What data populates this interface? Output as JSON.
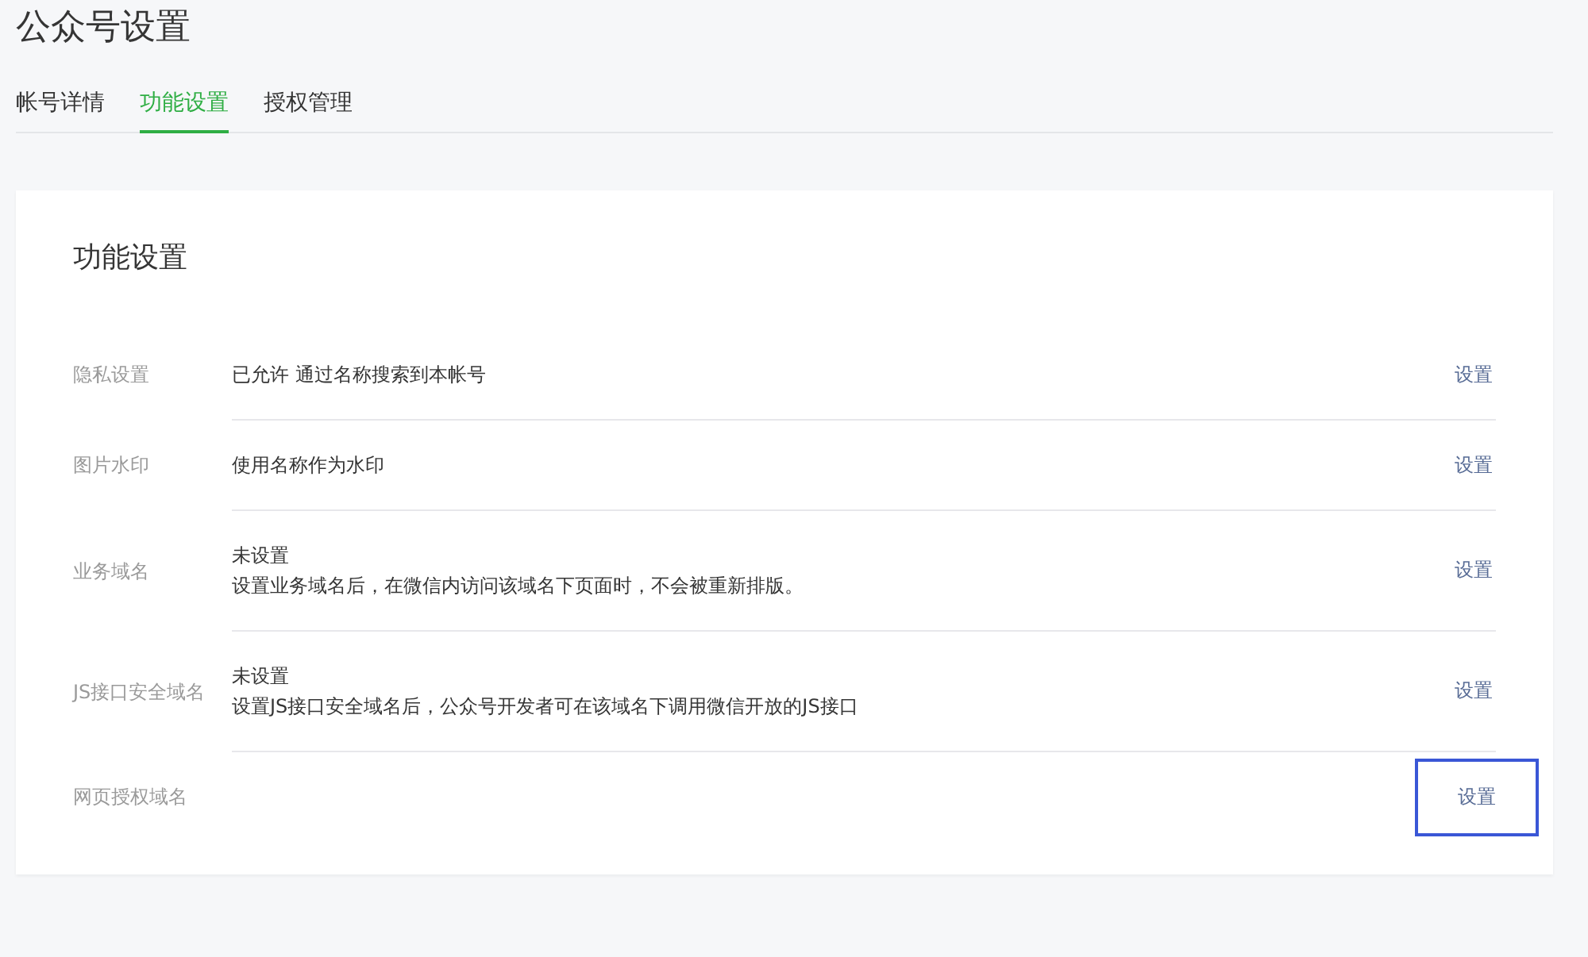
{
  "page_title": "公众号设置",
  "tabs": [
    {
      "label": "帐号详情",
      "selected": false
    },
    {
      "label": "功能设置",
      "selected": true
    },
    {
      "label": "授权管理",
      "selected": false
    }
  ],
  "card": {
    "title": "功能设置",
    "rows": [
      {
        "label": "隐私设置",
        "value_lines": [
          "已允许 通过名称搜索到本帐号"
        ],
        "action": "设置",
        "highlighted": false
      },
      {
        "label": "图片水印",
        "value_lines": [
          "使用名称作为水印"
        ],
        "action": "设置",
        "highlighted": false
      },
      {
        "label": "业务域名",
        "value_lines": [
          "未设置",
          "设置业务域名后，在微信内访问该域名下页面时，不会被重新排版。"
        ],
        "action": "设置",
        "highlighted": false
      },
      {
        "label": "JS接口安全域名",
        "value_lines": [
          "未设置",
          "设置JS接口安全域名后，公众号开发者可在该域名下调用微信开放的JS接口"
        ],
        "action": "设置",
        "highlighted": false
      },
      {
        "label": "网页授权域名",
        "value_lines": [],
        "action": "设置",
        "highlighted": true
      }
    ]
  }
}
